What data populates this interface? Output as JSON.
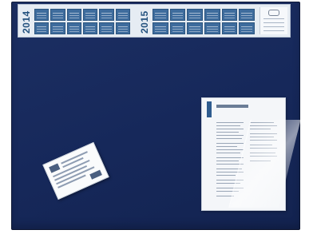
{
  "calendar": {
    "years": [
      {
        "label": "2014"
      },
      {
        "label": "2015"
      }
    ]
  },
  "colors": {
    "pad": "#182b5e",
    "calendar_bg": "#e6ecf3",
    "month_blue": "#3e6c9d",
    "paper": "#f4f6f9"
  }
}
